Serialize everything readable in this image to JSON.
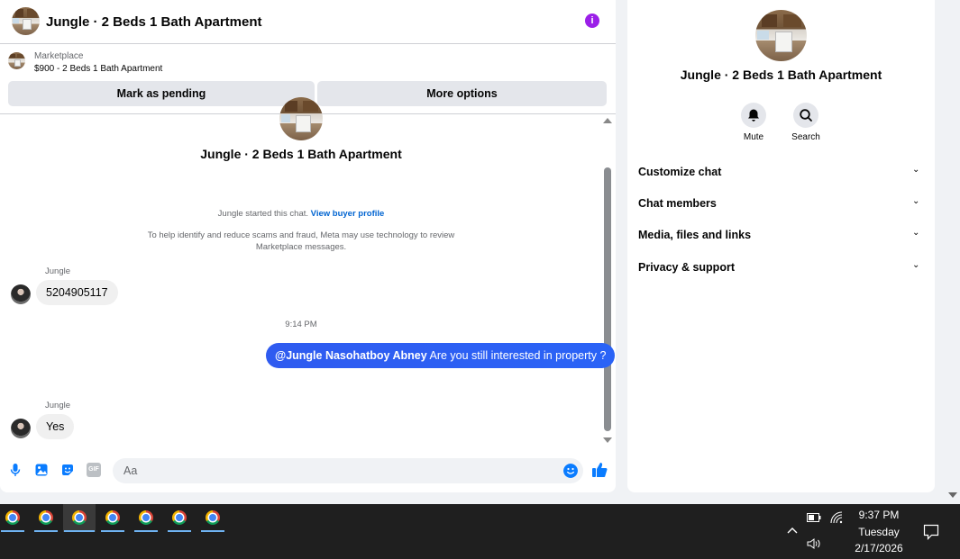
{
  "header": {
    "title": "Jungle · 2 Beds 1 Bath Apartment",
    "info_icon": "info-icon",
    "info_color": "#9b1fe8"
  },
  "listing": {
    "source": "Marketplace",
    "price_title": "$900 - 2 Beds 1 Bath Apartment",
    "mark_pending_label": "Mark as pending",
    "more_options_label": "More options"
  },
  "conversation": {
    "name": "Jungle · 2 Beds 1 Bath Apartment",
    "started_text": "Jungle started this chat. ",
    "view_profile_link": "View buyer profile",
    "notice": "To help identify and reduce scams and fraud, Meta may use technology to review Marketplace messages.",
    "messages": [
      {
        "sender": "Jungle",
        "text": "5204905117",
        "direction": "incoming"
      },
      {
        "time": "9:14 PM"
      },
      {
        "mention": "@Jungle Nasohatboy Abney",
        "text": " Are you still interested in property ?",
        "direction": "outgoing"
      },
      {
        "sender": "Jungle",
        "text": "Yes",
        "direction": "incoming"
      }
    ]
  },
  "composer": {
    "placeholder": "Aa",
    "icons": [
      "microphone-icon",
      "photo-icon",
      "sticker-icon",
      "gif-icon",
      "emoji-icon",
      "thumbs-up-icon"
    ],
    "gif_label": "GIF",
    "accent_color": "#0a7cff"
  },
  "details": {
    "title": "Jungle · 2 Beds 1 Bath Apartment",
    "mute_label": "Mute",
    "search_label": "Search",
    "sections": [
      "Customize chat",
      "Chat members",
      "Media, files and links",
      "Privacy & support"
    ]
  },
  "taskbar": {
    "apps": [
      "chrome-icon",
      "chrome-icon",
      "chrome-icon",
      "chrome-icon",
      "chrome-icon",
      "chrome-icon",
      "chrome-icon"
    ],
    "time": "9:37 PM",
    "day": "Tuesday",
    "date": "2/17/2026"
  }
}
